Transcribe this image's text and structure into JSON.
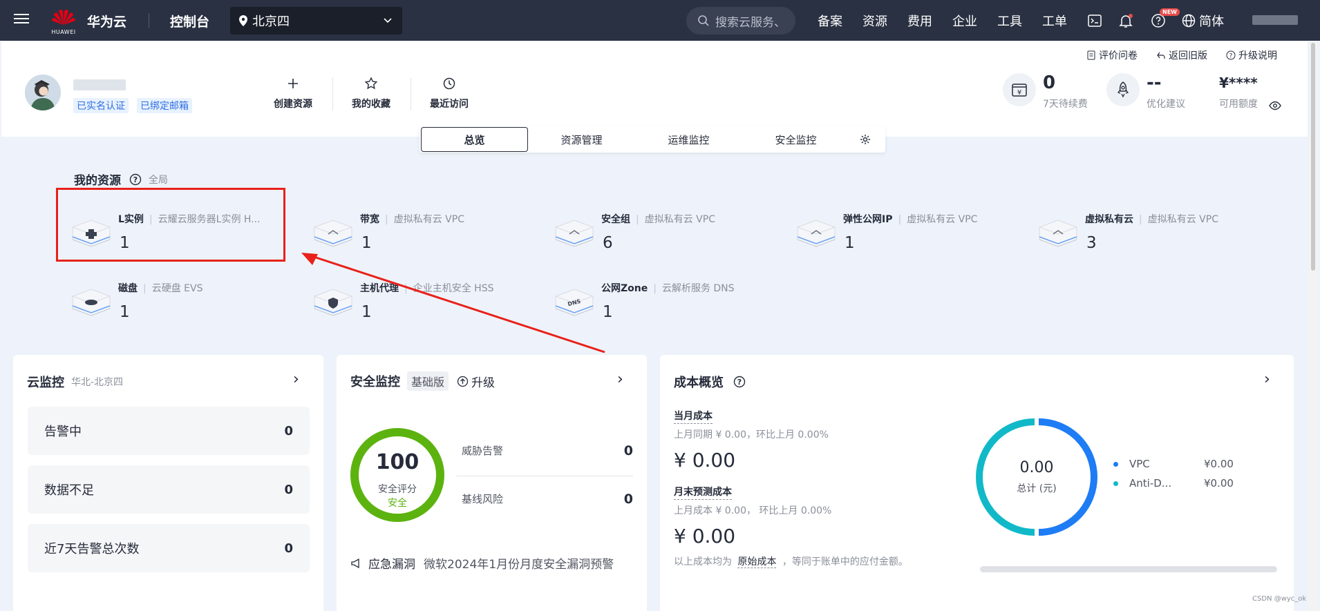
{
  "topbar": {
    "brand_label": "HUAWEI",
    "brand_name": "华为云",
    "console_title": "控制台",
    "region": "北京四",
    "search_placeholder": "搜索云服务、",
    "nav": [
      "备案",
      "资源",
      "费用",
      "企业",
      "工具",
      "工单"
    ],
    "new_badge": "NEW",
    "language": "简体"
  },
  "header": {
    "links": [
      "评价问卷",
      "返回旧版",
      "升级说明"
    ],
    "tags": [
      "已实名认证",
      "已绑定邮箱"
    ],
    "quick": [
      "创建资源",
      "我的收藏",
      "最近访问"
    ],
    "stats": [
      {
        "value": "0",
        "label": "7天待续费"
      },
      {
        "value": "--",
        "label": "优化建议"
      },
      {
        "value": "¥****",
        "label": "可用额度"
      }
    ]
  },
  "tabs": [
    "总览",
    "资源管理",
    "运维监控",
    "安全监控"
  ],
  "resources": {
    "title": "我的资源",
    "scope": "全局",
    "items": [
      {
        "name": "L实例",
        "service": "云耀云服务器L实例 H...",
        "count": "1"
      },
      {
        "name": "带宽",
        "service": "虚拟私有云 VPC",
        "count": "1"
      },
      {
        "name": "安全组",
        "service": "虚拟私有云 VPC",
        "count": "6"
      },
      {
        "name": "弹性公网IP",
        "service": "虚拟私有云 VPC",
        "count": "1"
      },
      {
        "name": "虚拟私有云",
        "service": "虚拟私有云 VPC",
        "count": "3"
      },
      {
        "name": "磁盘",
        "service": "云硬盘 EVS",
        "count": "1"
      },
      {
        "name": "主机代理",
        "service": "企业主机安全 HSS",
        "count": "1"
      },
      {
        "name": "公网Zone",
        "service": "云解析服务 DNS",
        "count": "1"
      }
    ]
  },
  "monitor": {
    "title": "云监控",
    "region": "华北-北京四",
    "rows": [
      {
        "label": "告警中",
        "value": "0"
      },
      {
        "label": "数据不足",
        "value": "0"
      },
      {
        "label": "近7天告警总次数",
        "value": "0"
      }
    ]
  },
  "security": {
    "title": "安全监控",
    "edition": "基础版",
    "upgrade": "升级",
    "score": "100",
    "score_label": "安全评分",
    "score_status": "安全",
    "rows": [
      {
        "label": "威胁告警",
        "value": "0"
      },
      {
        "label": "基线风险",
        "value": "0"
      }
    ],
    "vuln_label": "应急漏洞",
    "vuln_text": "微软2024年1月份月度安全漏洞预警"
  },
  "cost": {
    "title": "成本概览",
    "month_label": "当月成本",
    "month_sub": "上月同期 ¥ 0.00，环比上月  0.00%",
    "month_value": "¥ 0.00",
    "forecast_label": "月末预测成本",
    "forecast_sub": "上月成本 ¥ 0.00， 环比上月  0.00%",
    "forecast_value": "¥ 0.00",
    "note_prefix": "以上成本均为",
    "note_link": "原始成本",
    "note_suffix": "，等同于账单中的应付金额。",
    "donut_value": "0.00",
    "donut_label": "总计 (元)",
    "legend": [
      {
        "name": "VPC",
        "value": "¥0.00",
        "color": "#1e7cf5"
      },
      {
        "name": "Anti-D...",
        "value": "¥0.00",
        "color": "#11b9c8"
      }
    ]
  },
  "colors": {
    "accent": "#1e7cf5",
    "teal": "#11b9c8",
    "green": "#5cb30f",
    "highlight": "#e8211a"
  },
  "watermark": "CSDN @wyc_ok"
}
